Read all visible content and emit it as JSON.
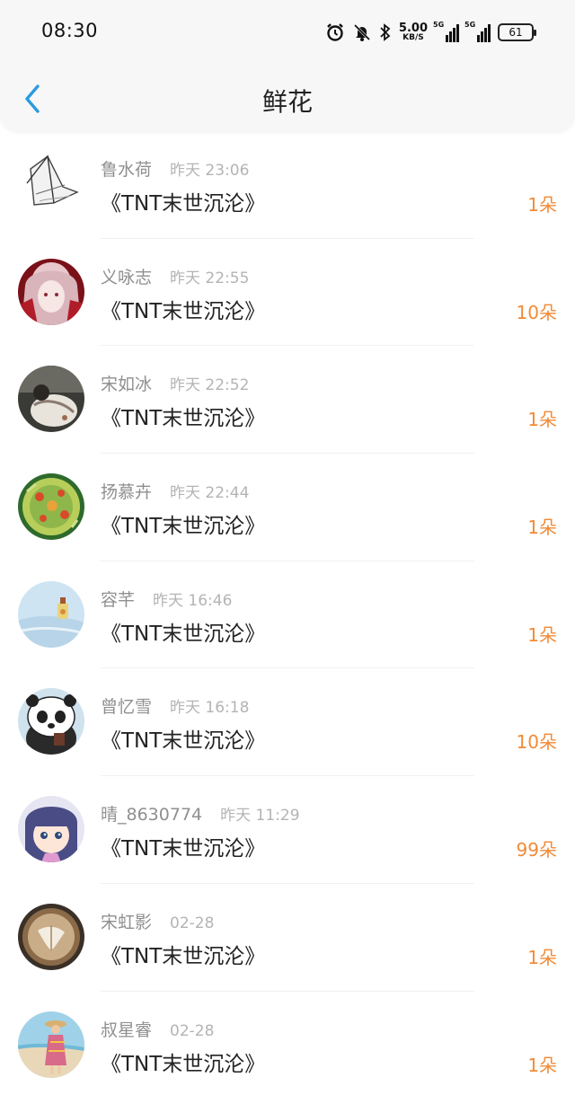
{
  "status_bar": {
    "time": "08:30",
    "speed_value": "5.00",
    "speed_unit": "KB/S",
    "signal_1_label": "5G",
    "signal_2_label": "5G",
    "battery": "61",
    "icons": [
      "alarm-icon",
      "bell-off-icon",
      "bluetooth-icon",
      "signal-icon",
      "battery-icon"
    ]
  },
  "header": {
    "title": "鲜花",
    "back_icon": "chevron-left-icon"
  },
  "colors": {
    "accent_back": "#2a9be0",
    "count_orange": "#f28a36",
    "username_gray": "#8f8f8f",
    "time_gray": "#b4b4b4"
  },
  "items": [
    {
      "username": "鲁水荷",
      "time": "昨天 23:06",
      "book": "《TNT末世沉沦》",
      "count": "1朵",
      "avatar": "sketch-avatar"
    },
    {
      "username": "义咏志",
      "time": "昨天 22:55",
      "book": "《TNT末世沉沦》",
      "count": "10朵",
      "avatar": "anime-girl-avatar"
    },
    {
      "username": "宋如冰",
      "time": "昨天 22:52",
      "book": "《TNT末世沉沦》",
      "count": "1朵",
      "avatar": "photo-avatar"
    },
    {
      "username": "扬慕卉",
      "time": "昨天 22:44",
      "book": "《TNT末世沉沦》",
      "count": "1朵",
      "avatar": "food-avatar"
    },
    {
      "username": "容芊",
      "time": "昨天 16:46",
      "book": "《TNT末世沉沦》",
      "count": "1朵",
      "avatar": "sky-bottle-avatar"
    },
    {
      "username": "曾忆雪",
      "time": "昨天 16:18",
      "book": "《TNT末世沉沦》",
      "count": "10朵",
      "avatar": "panda-avatar"
    },
    {
      "username": "晴_8630774",
      "time": "昨天 11:29",
      "book": "《TNT末世沉沦》",
      "count": "99朵",
      "avatar": "cartoon-girl-avatar"
    },
    {
      "username": "宋虹影",
      "time": "02-28",
      "book": "《TNT末世沉沦》",
      "count": "1朵",
      "avatar": "latte-avatar"
    },
    {
      "username": "叔星睿",
      "time": "02-28",
      "book": "《TNT末世沉沦》",
      "count": "1朵",
      "avatar": "beach-avatar"
    }
  ]
}
